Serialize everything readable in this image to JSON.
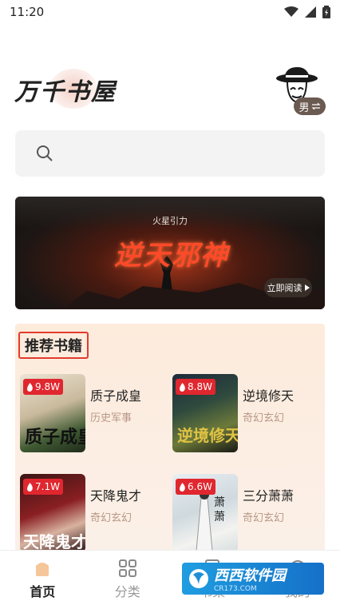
{
  "status": {
    "time": "11:20"
  },
  "header": {
    "logo": "万千书屋",
    "gender": "男",
    "gender_switch_icon": "swap-icon"
  },
  "search": {
    "placeholder": ""
  },
  "banner": {
    "brand": "火星引力",
    "title": "逆天邪神",
    "button": "立即阅读"
  },
  "recommend": {
    "title": "推荐书籍",
    "books": [
      {
        "heat": "9.8W",
        "title": "质子成皇",
        "genre": "历史军事"
      },
      {
        "heat": "8.8W",
        "title": "逆境修天",
        "genre": "奇幻玄幻"
      },
      {
        "heat": "7.1W",
        "title": "天降鬼才",
        "genre": "奇幻玄幻"
      },
      {
        "heat": "6.6W",
        "title": "三分萧萧",
        "genre": "奇幻玄幻"
      }
    ]
  },
  "tabbar": {
    "tabs": [
      {
        "label": "首页"
      },
      {
        "label": "分类"
      },
      {
        "label": "书架"
      },
      {
        "label": "我的"
      }
    ]
  },
  "watermark": {
    "main": "西西软件园",
    "sub": "CR173.COM"
  },
  "colors": {
    "accent_red": "#e23b2e",
    "heat_badge": "#e0272f",
    "genre": "#b89886"
  }
}
